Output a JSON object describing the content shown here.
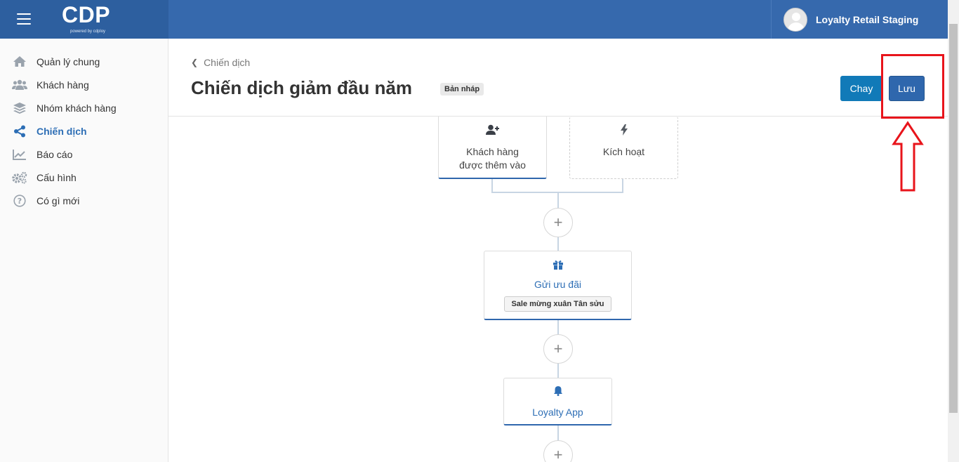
{
  "header": {
    "logo_text": "CDP",
    "logo_sub": "powered by cdploy",
    "user_name": "Loyalty Retail Staging"
  },
  "sidebar": {
    "items": [
      {
        "label": "Quản lý chung",
        "icon": "home-icon"
      },
      {
        "label": "Khách hàng",
        "icon": "users-icon"
      },
      {
        "label": "Nhóm khách hàng",
        "icon": "layers-icon"
      },
      {
        "label": "Chiến dịch",
        "icon": "share-icon",
        "active": true
      },
      {
        "label": "Báo cáo",
        "icon": "chart-icon"
      },
      {
        "label": "Cấu hình",
        "icon": "gears-icon"
      },
      {
        "label": "Có gì mới",
        "icon": "question-icon"
      }
    ]
  },
  "main": {
    "breadcrumb": "Chiến dịch",
    "title": "Chiến dịch giảm đầu năm",
    "status": "Bản nháp",
    "run_label": "Chay",
    "save_label": "Lưu"
  },
  "flow": {
    "trigger_customer_added": "Khách hàng được thêm vào",
    "trigger_activation": "Kích hoạt",
    "send_offer_title": "Gửi ưu đãi",
    "send_offer_tag": "Sale mừng xuân Tân sửu",
    "loyalty_app_title": "Loyalty App",
    "plus_symbol": "+"
  },
  "colors": {
    "topbar": "#3669ad",
    "accent": "#2d6eb5",
    "run_button": "#117ab8",
    "annotation": "#e8141b"
  }
}
